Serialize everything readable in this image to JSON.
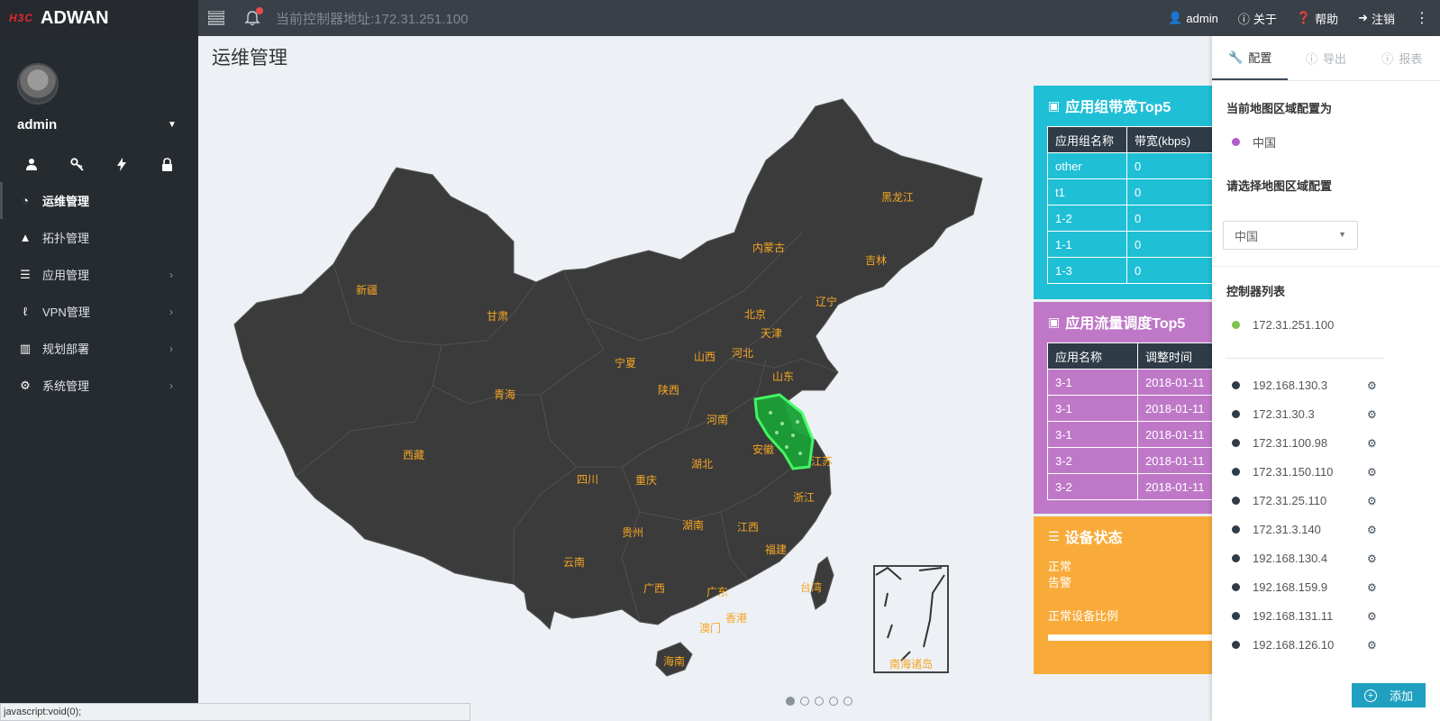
{
  "brand": {
    "logo_text": "H3C",
    "name": "ADWAN"
  },
  "topbar": {
    "controller_address": "当前控制器地址:172.31.251.100",
    "user": "admin",
    "about": "关于",
    "help": "帮助",
    "logout": "注销"
  },
  "sidebar": {
    "username": "admin",
    "items": [
      {
        "label": "运维管理",
        "icon": "dashboard-icon"
      },
      {
        "label": "拓扑管理",
        "icon": "sitemap-icon"
      },
      {
        "label": "应用管理",
        "icon": "list-icon"
      },
      {
        "label": "VPN管理",
        "icon": "vpn-icon"
      },
      {
        "label": "规划部署",
        "icon": "signal-icon"
      },
      {
        "label": "系统管理",
        "icon": "cogs-icon"
      }
    ]
  },
  "main": {
    "title": "运维管理",
    "map_provinces": [
      "新疆",
      "甘肃",
      "青海",
      "西藏",
      "内蒙古",
      "黑龙江",
      "吉林",
      "辽宁",
      "北京",
      "天津",
      "河北",
      "山西",
      "山东",
      "宁夏",
      "陕西",
      "河南",
      "江苏",
      "安徽",
      "湖北",
      "四川",
      "重庆",
      "浙江",
      "贵州",
      "湖南",
      "江西",
      "福建",
      "云南",
      "广西",
      "广东",
      "台湾",
      "澳门",
      "香港",
      "海南",
      "南海诸岛"
    ],
    "pager_count": 5,
    "pager_active": 0
  },
  "panels": {
    "bandwidth": {
      "title": "应用组带宽Top5",
      "headers": [
        "应用组名称",
        "带宽(kbps)"
      ],
      "rows": [
        [
          "other",
          "0"
        ],
        [
          "t1",
          "0"
        ],
        [
          "1-2",
          "0"
        ],
        [
          "1-1",
          "0"
        ],
        [
          "1-3",
          "0"
        ]
      ]
    },
    "traffic": {
      "title": "应用流量调度Top5",
      "headers": [
        "应用名称",
        "调整时间"
      ],
      "rows": [
        [
          "3-1",
          "2018-01-11"
        ],
        [
          "3-1",
          "2018-01-11"
        ],
        [
          "3-1",
          "2018-01-11"
        ],
        [
          "3-2",
          "2018-01-11"
        ],
        [
          "3-2",
          "2018-01-11"
        ]
      ]
    },
    "device": {
      "title": "设备状态",
      "normal": "正常",
      "alarm": "告警",
      "ratio_label": "正常设备比例"
    }
  },
  "config": {
    "tabs": [
      "配置",
      "导出",
      "报表"
    ],
    "current_region_label": "当前地图区域配置为",
    "current_region": "中国",
    "select_region_label": "请选择地图区域配置",
    "select_value": "中国",
    "controller_list_label": "控制器列表",
    "active_controller": "172.31.251.100",
    "controllers": [
      "192.168.130.3",
      "172.31.30.3",
      "172.31.100.98",
      "172.31.150.110",
      "172.31.25.110",
      "172.31.3.140",
      "192.168.130.4",
      "192.168.159.9",
      "192.168.131.11",
      "192.168.126.10"
    ],
    "add_label": "添加",
    "colors": {
      "region_dot": "#b15cc9",
      "active_dot": "#7cc24a",
      "controller_dot": "#2f3b47"
    }
  },
  "statusbar": {
    "text": "javascript:void(0);"
  }
}
